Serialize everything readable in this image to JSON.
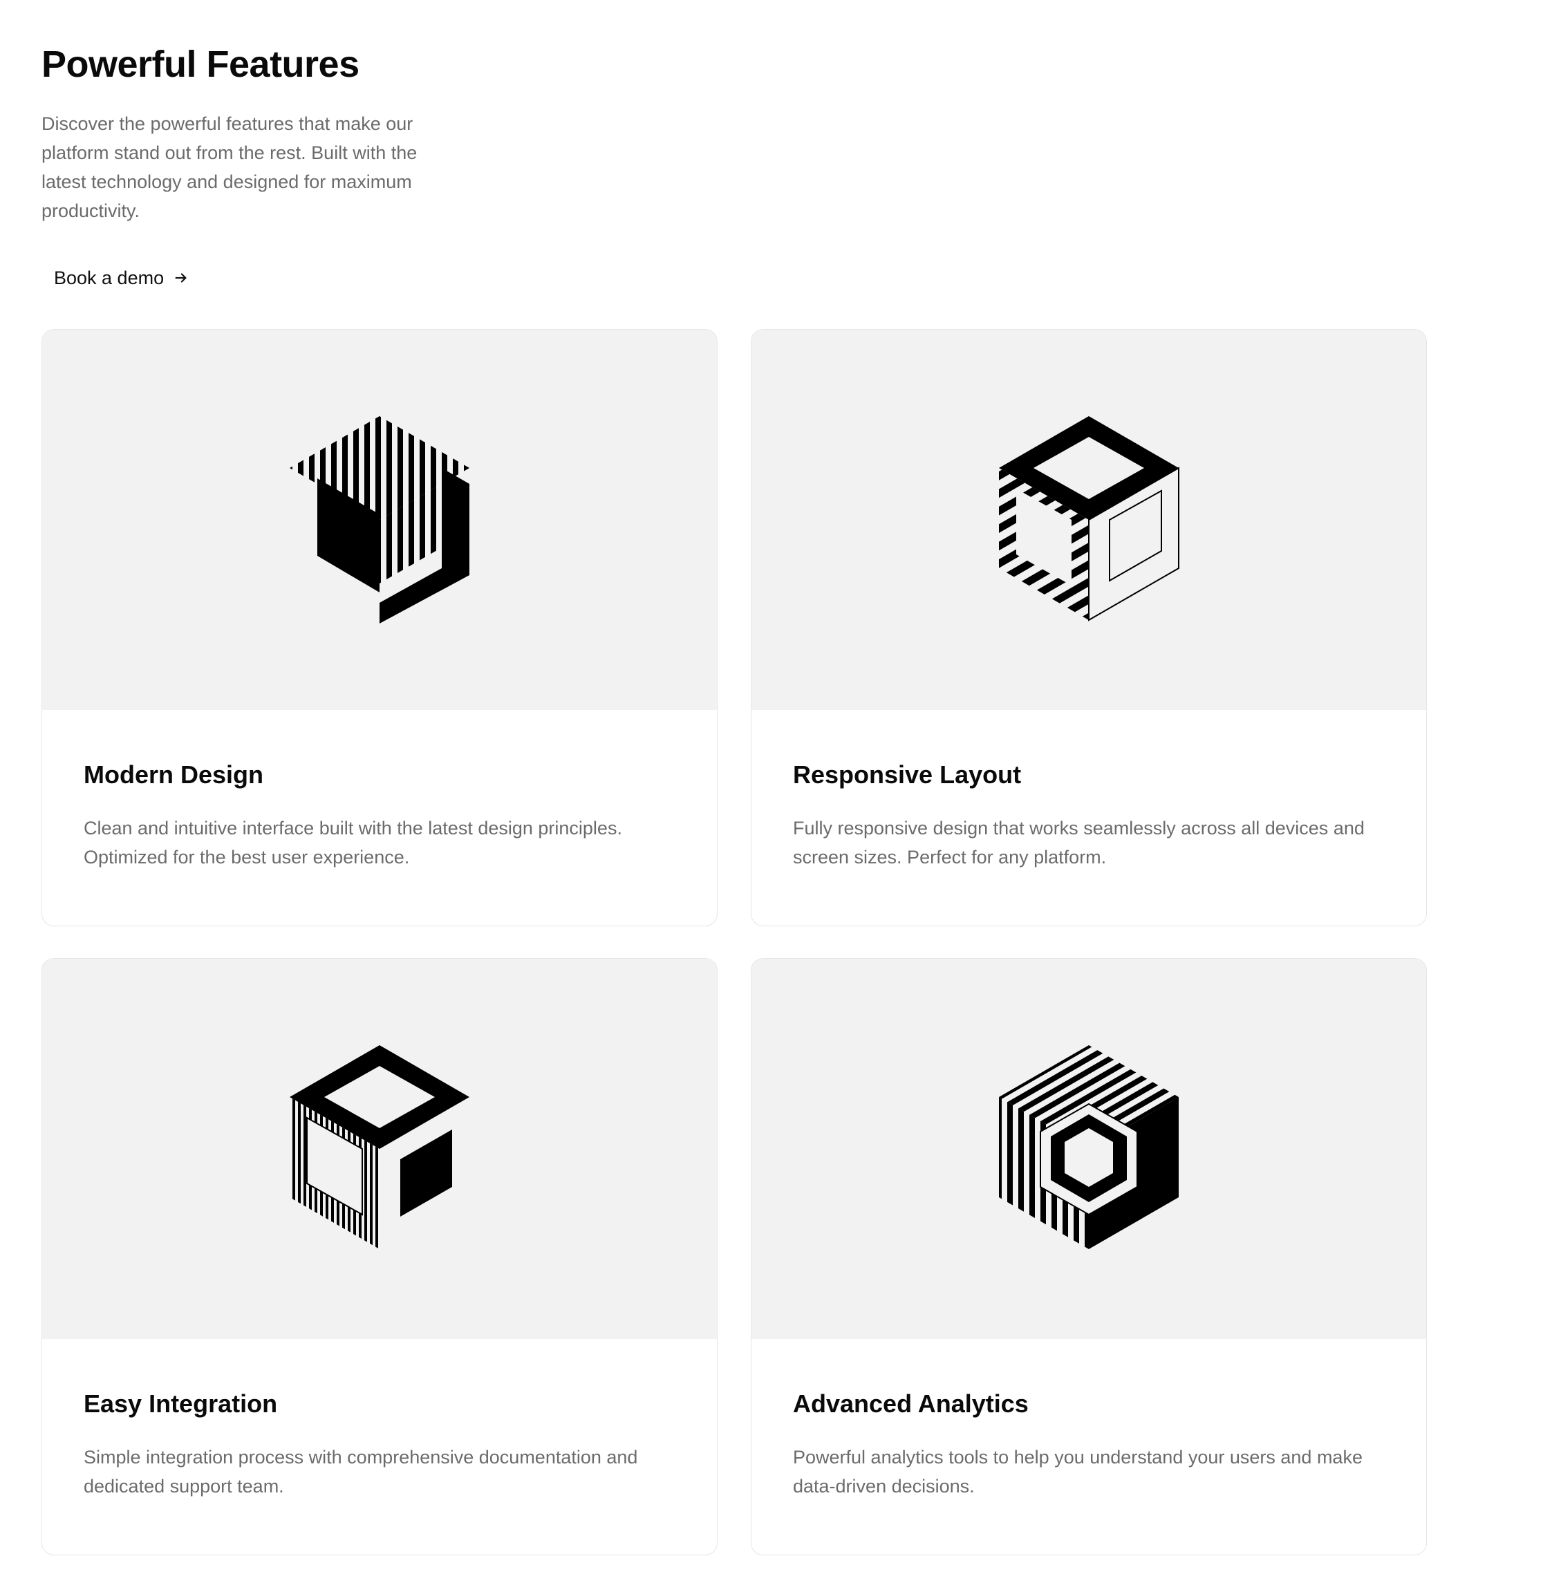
{
  "header": {
    "title": "Powerful Features",
    "description": "Discover the powerful features that make our platform stand out from the rest. Built with the latest technology and designed for maximum productivity.",
    "cta_label": "Book a demo",
    "cta_icon": "arrow-right-icon"
  },
  "features": [
    {
      "title": "Modern Design",
      "description": "Clean and intuitive interface built with the latest design principles. Optimized for the best user experience.",
      "icon": "striped-cube-icon"
    },
    {
      "title": "Responsive Layout",
      "description": "Fully responsive design that works seamlessly across all devices and screen sizes. Perfect for any platform.",
      "icon": "framed-cube-icon"
    },
    {
      "title": "Easy Integration",
      "description": "Simple integration process with comprehensive documentation and dedicated support team.",
      "icon": "solid-cube-icon"
    },
    {
      "title": "Advanced Analytics",
      "description": "Powerful analytics tools to help you understand your users and make data-driven decisions.",
      "icon": "layered-cube-icon"
    }
  ],
  "colors": {
    "background": "#ffffff",
    "card_media_bg": "#f2f2f2",
    "text_primary": "#0a0a0a",
    "text_muted": "#6b6b6b",
    "border": "#e6e6e6"
  }
}
